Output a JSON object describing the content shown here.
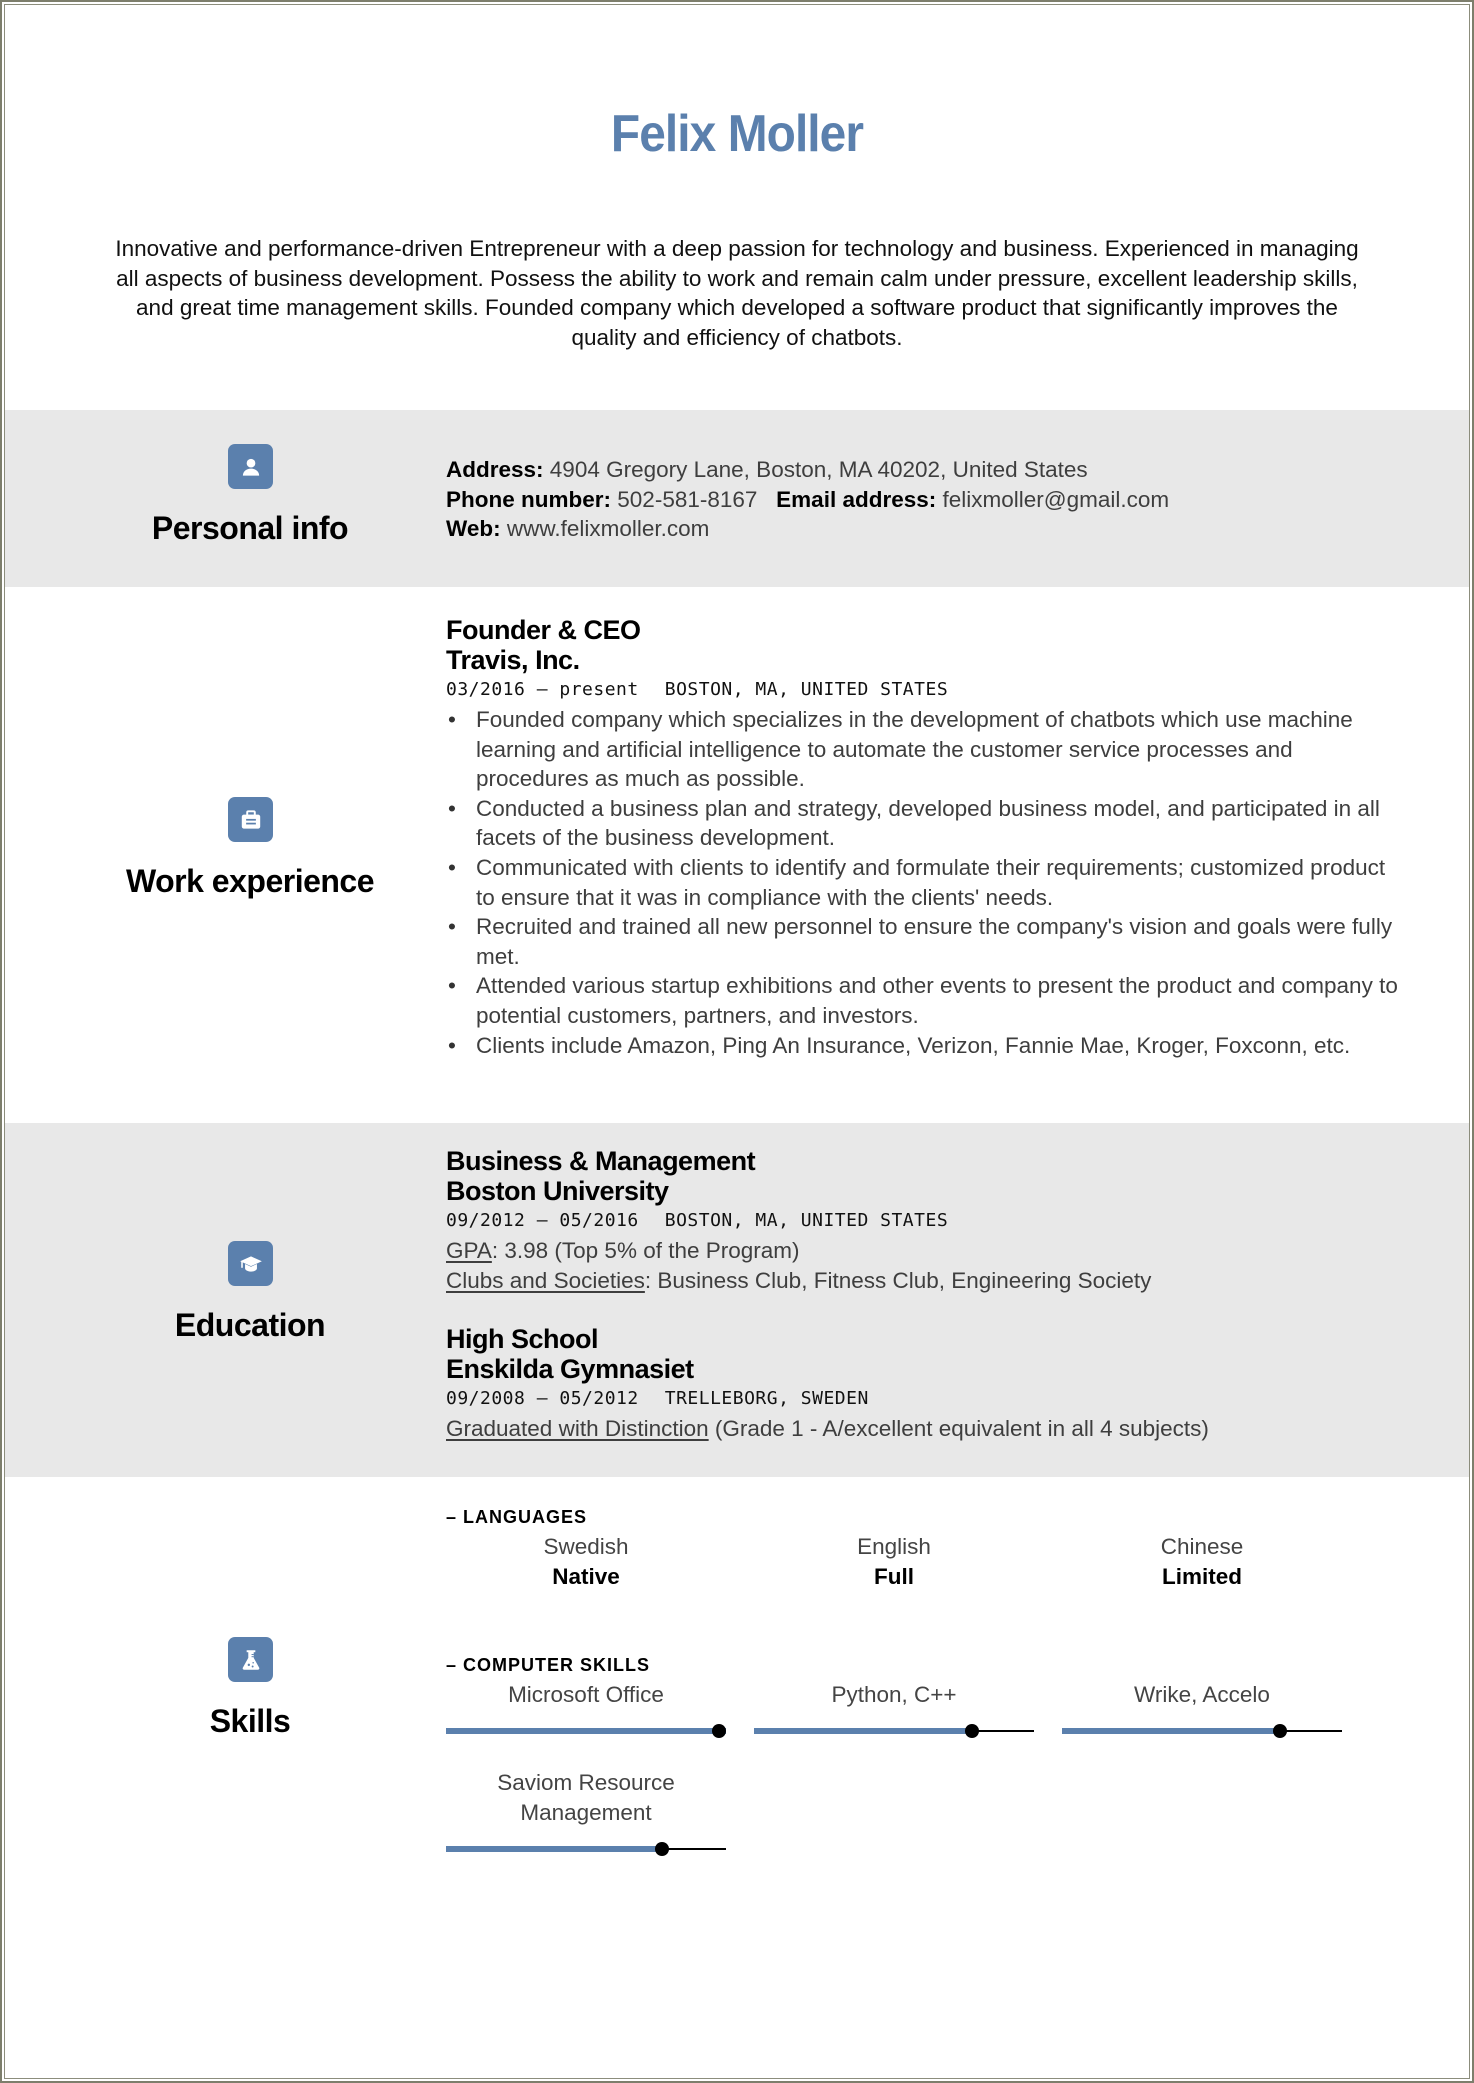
{
  "header": {
    "name": "Felix Moller",
    "summary": "Innovative and performance-driven Entrepreneur with a deep passion for technology and business. Experienced in managing all aspects of business development. Possess the ability to work and remain calm under pressure, excellent leadership skills, and great time management skills. Founded company which developed a software product that significantly improves the quality and efficiency of chatbots.",
    "accent_color": "#5b80ad"
  },
  "personal_info": {
    "title": "Personal info",
    "icon": "user-icon",
    "address_label": "Address:",
    "address": "4904 Gregory Lane, Boston, MA 40202, United States",
    "phone_label": "Phone number:",
    "phone": "502-581-8167",
    "email_label": "Email address:",
    "email": "felixmoller@gmail.com",
    "web_label": "Web:",
    "web": "www.felixmoller.com"
  },
  "work_experience": {
    "title": "Work experience",
    "icon": "briefcase-icon",
    "jobs": [
      {
        "position": "Founder & CEO",
        "company": "Travis, Inc.",
        "dates": "03/2016 – present",
        "location": "BOSTON, MA, UNITED STATES",
        "bullets": [
          "Founded company which specializes in the development of chatbots which use machine learning and artificial intelligence to automate the customer service processes and procedures as much as possible.",
          "Conducted a business plan and strategy, developed business model, and participated in all facets of the business development.",
          "Communicated with clients to identify and formulate their requirements; customized product to ensure that it was in compliance with the clients' needs.",
          "Recruited and trained all new personnel to ensure the company's vision and goals were fully met.",
          "Attended various startup exhibitions and other events to present the product and company to potential customers, partners, and investors.",
          "Clients include Amazon, Ping An Insurance, Verizon, Fannie Mae, Kroger, Foxconn, etc."
        ]
      }
    ]
  },
  "education": {
    "title": "Education",
    "icon": "graduation-cap-icon",
    "entries": [
      {
        "degree": "Business & Management",
        "school": "Boston University",
        "dates": "09/2012 – 05/2016",
        "location": "BOSTON, MA, UNITED STATES",
        "details": [
          {
            "label": "GPA",
            "text": ": 3.98 (Top 5% of the Program)"
          },
          {
            "label": "Clubs and Societies",
            "text": ": Business Club, Fitness Club, Engineering Society"
          }
        ]
      },
      {
        "degree": "High School",
        "school": "Enskilda Gymnasiet",
        "dates": "09/2008 – 05/2012",
        "location": "TRELLEBORG, SWEDEN",
        "details": [
          {
            "label": "Graduated with Distinction",
            "text": " (Grade 1 - A/excellent equivalent in all 4 subjects)"
          }
        ]
      }
    ]
  },
  "skills": {
    "title": "Skills",
    "icon": "flask-icon",
    "languages_heading": "– LANGUAGES",
    "languages": [
      {
        "name": "Swedish",
        "level": "Native"
      },
      {
        "name": "English",
        "level": "Full"
      },
      {
        "name": "Chinese",
        "level": "Limited"
      }
    ],
    "computer_heading": "– COMPUTER SKILLS",
    "computer_skills": [
      {
        "name": "Microsoft Office",
        "level": 1.0
      },
      {
        "name": "Python, C++",
        "level": 0.78
      },
      {
        "name": "Wrike, Accelo",
        "level": 0.78
      },
      {
        "name": "Saviom Resource Management",
        "level": 0.77
      }
    ]
  }
}
